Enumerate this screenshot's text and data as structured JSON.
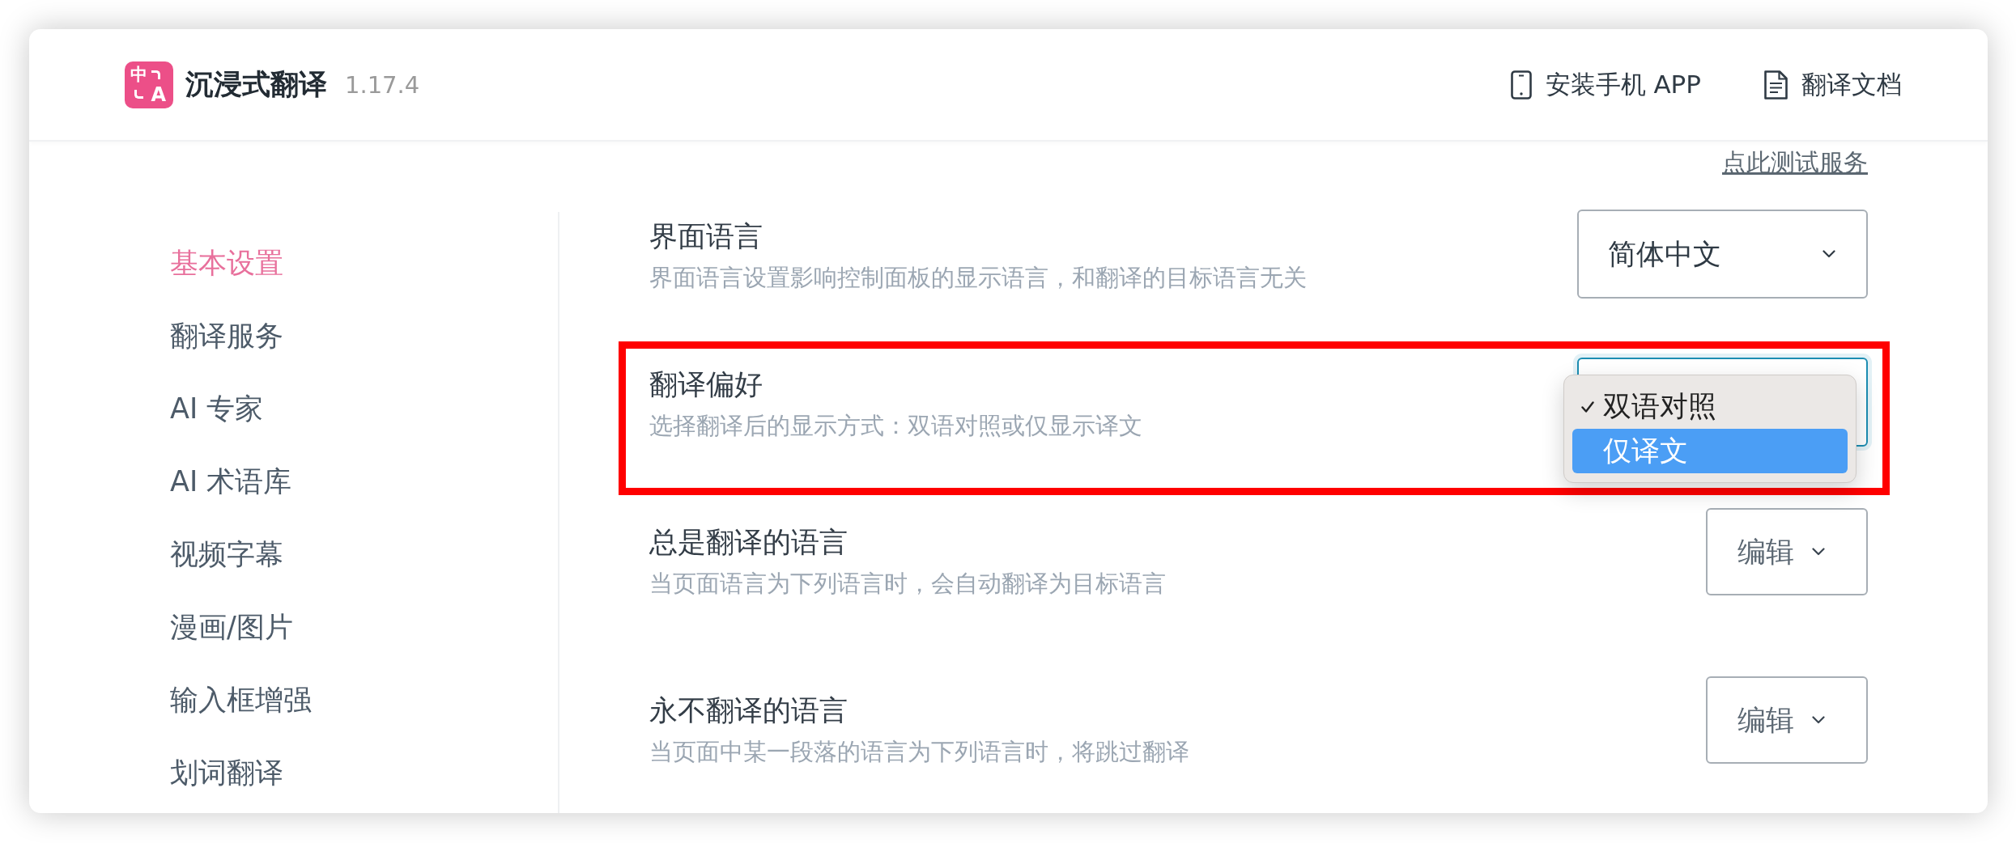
{
  "header": {
    "logo": {
      "letters": [
        "中",
        "A"
      ]
    },
    "title": "沉浸式翻译",
    "version": "1.17.4",
    "links": [
      {
        "kind": "phone",
        "label": "安装手机 APP"
      },
      {
        "kind": "document",
        "label": "翻译文档"
      }
    ]
  },
  "test_link": "点此测试服务",
  "sidebar": {
    "items": [
      {
        "label": "基本设置",
        "selected": true
      },
      {
        "label": "翻译服务",
        "selected": false
      },
      {
        "label": "AI 专家",
        "selected": false
      },
      {
        "label": "AI 术语库",
        "selected": false
      },
      {
        "label": "视频字幕",
        "selected": false
      },
      {
        "label": "漫画/图片",
        "selected": false
      },
      {
        "label": "输入框增强",
        "selected": false
      },
      {
        "label": "划词翻译",
        "selected": false
      }
    ]
  },
  "settings": [
    {
      "title": "界面语言",
      "description": "界面语言设置影响控制面板的显示语言，和翻译的目标语言无关",
      "highlighted": false,
      "control": {
        "kind": "select",
        "value": "简体中文",
        "focused": false
      }
    },
    {
      "title": "翻译偏好",
      "description": "选择翻译后的显示方式：双语对照或仅显示译文",
      "highlighted": true,
      "control": {
        "kind": "select",
        "focused": true,
        "options": [
          {
            "label": "双语对照",
            "selected": true,
            "hovered": false
          },
          {
            "label": "仅译文",
            "selected": false,
            "hovered": true
          }
        ]
      }
    },
    {
      "title": "总是翻译的语言",
      "description": "当页面语言为下列语言时，会自动翻译为目标语言",
      "highlighted": false,
      "control": {
        "kind": "menu-button",
        "label": "编辑"
      }
    },
    {
      "title": "永不翻译的语言",
      "description": "当页面中某一段落的语言为下列语言时，将跳过翻译",
      "highlighted": false,
      "control": {
        "kind": "menu-button",
        "label": "编辑"
      }
    }
  ]
}
